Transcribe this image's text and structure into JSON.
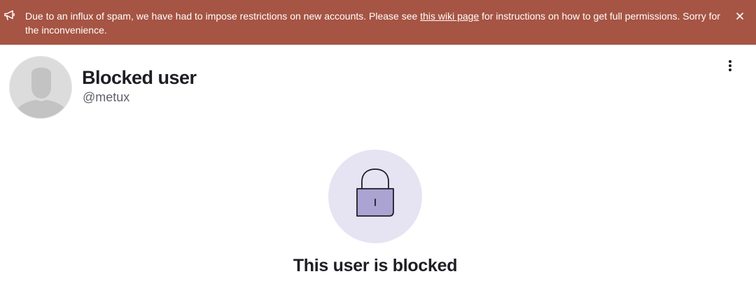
{
  "banner": {
    "text_before_link": "Due to an influx of spam, we have had to impose restrictions on new accounts. Please see ",
    "link_text": "this wiki page",
    "text_after_link": " for instructions on how to get full permissions. Sorry for the inconvenience.",
    "icon": "megaphone-icon",
    "close_icon": "close-icon",
    "background_color": "#a65443"
  },
  "profile": {
    "display_name": "Blocked user",
    "username": "@metux",
    "avatar_icon": "default-avatar-icon",
    "menu_icon": "kebab-menu-icon"
  },
  "blocked": {
    "title": "This user is blocked",
    "icon": "lock-icon",
    "circle_color": "#e6e4f3",
    "lock_color": "#aba3d2"
  }
}
